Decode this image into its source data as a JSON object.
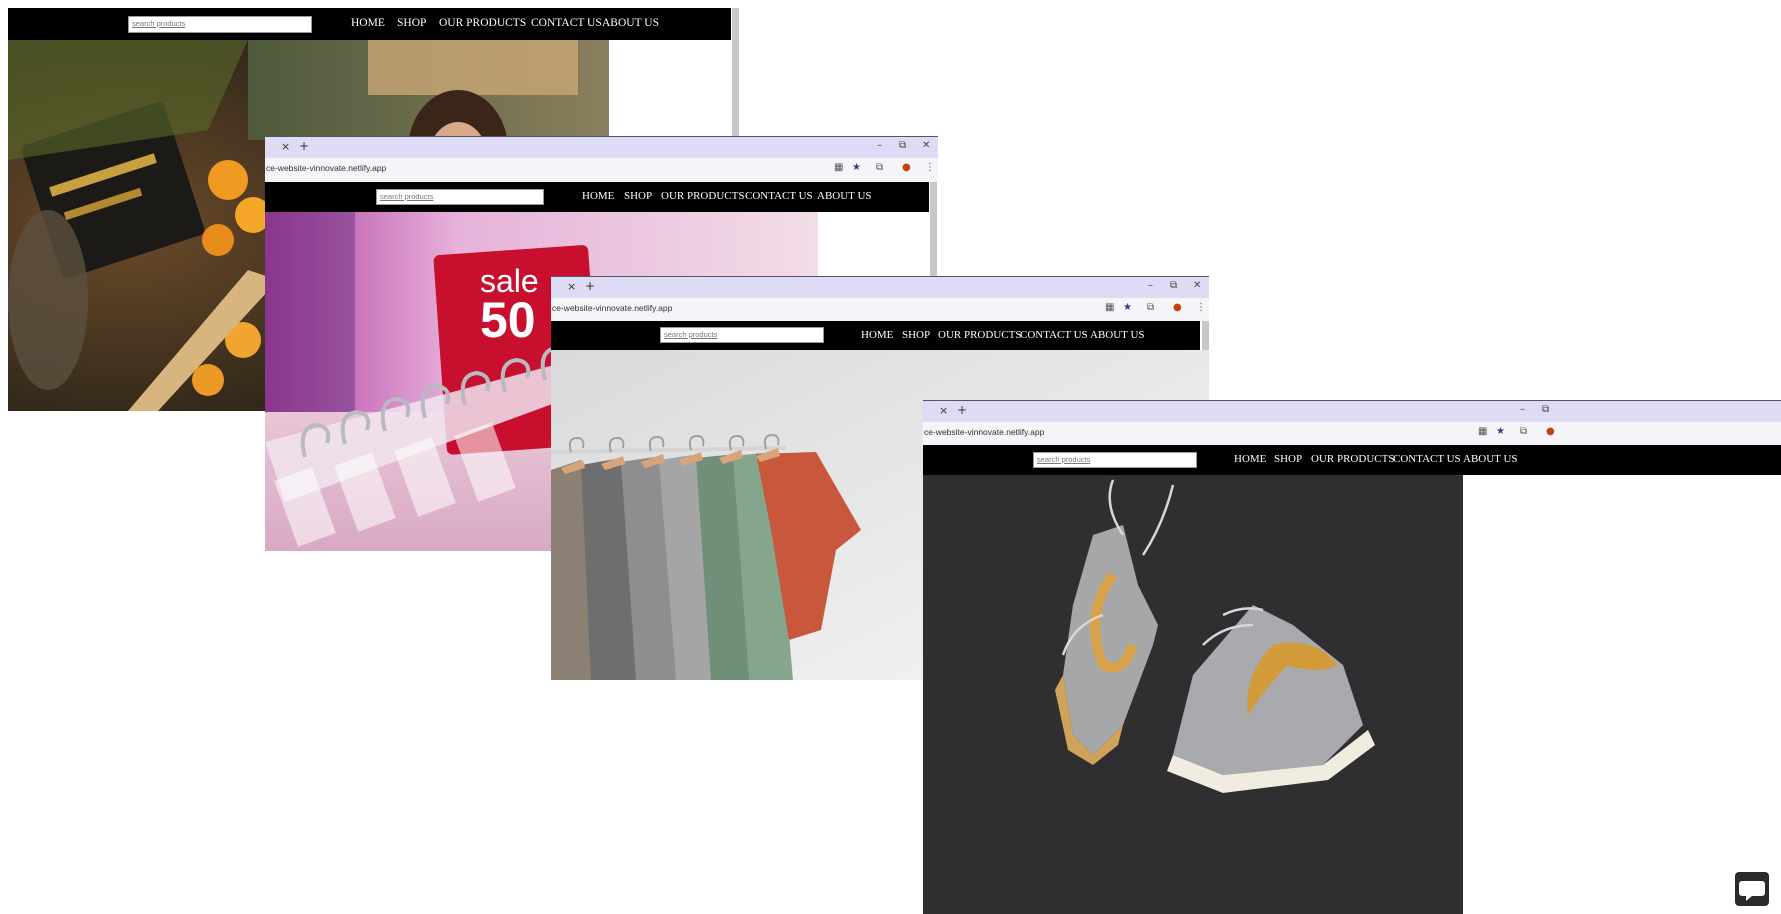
{
  "site": {
    "url": "ce-website-vinnovate.netlify.app",
    "search_placeholder": "search products",
    "nav": [
      "HOME",
      "SHOP",
      "OUR PRODUCTS",
      "CONTACT US",
      "ABOUT US"
    ]
  },
  "window_controls": {
    "close_tab": "×",
    "new_tab": "+",
    "minimize": "–",
    "restore": "⧉",
    "close": "✕"
  },
  "hero_images": {
    "w1": "grocery-fruit-shelf-photo",
    "w2": "sale-50-hangers-photo",
    "sale_sign": {
      "word": "sale",
      "number": "50"
    },
    "w3": "shirts-on-rack-photo",
    "w4": "sneakers-photo"
  },
  "colors": {
    "navbar": "#000000",
    "tabbar": "#dedcf4",
    "urlbar": "#f5f5f9",
    "sale_red": "#c8102e"
  },
  "icons": [
    "translate-icon",
    "bookmark-star-icon",
    "extensions-icon",
    "profile-icon",
    "menu-icon",
    "chat-icon"
  ]
}
